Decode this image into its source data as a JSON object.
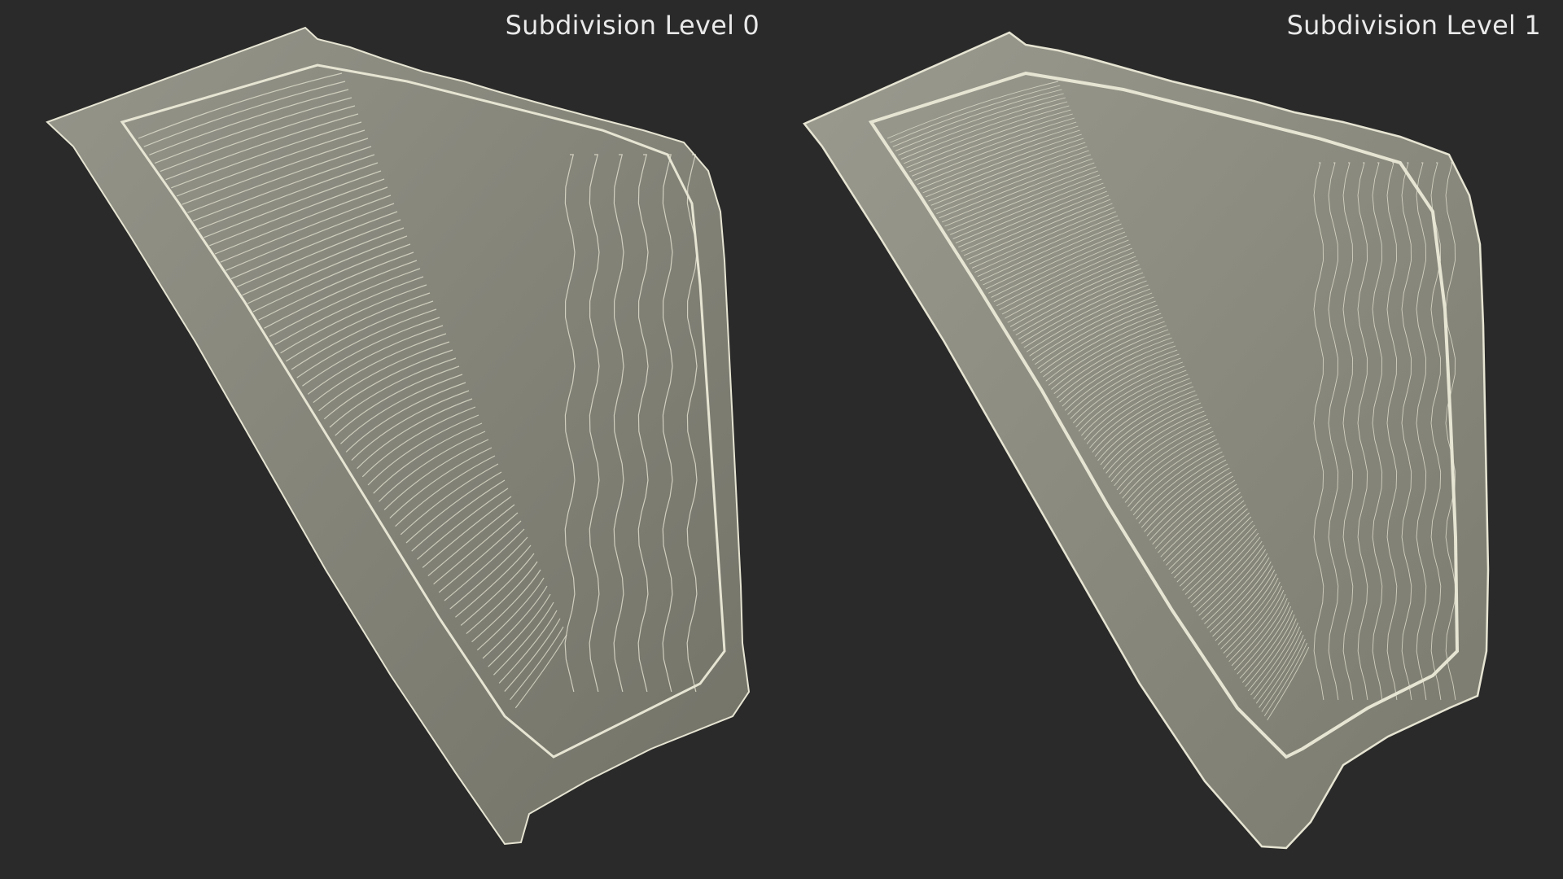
{
  "panels": [
    {
      "label": "Subdivision Level 0",
      "density": 0
    },
    {
      "label": "Subdivision Level 1",
      "density": 1
    }
  ],
  "colors": {
    "background": "#2a2a2a",
    "surface": "#8a8a7c",
    "surface_dark": "#6f6f63",
    "wire": "#e6e4d2",
    "label": "#e9e9e9"
  }
}
